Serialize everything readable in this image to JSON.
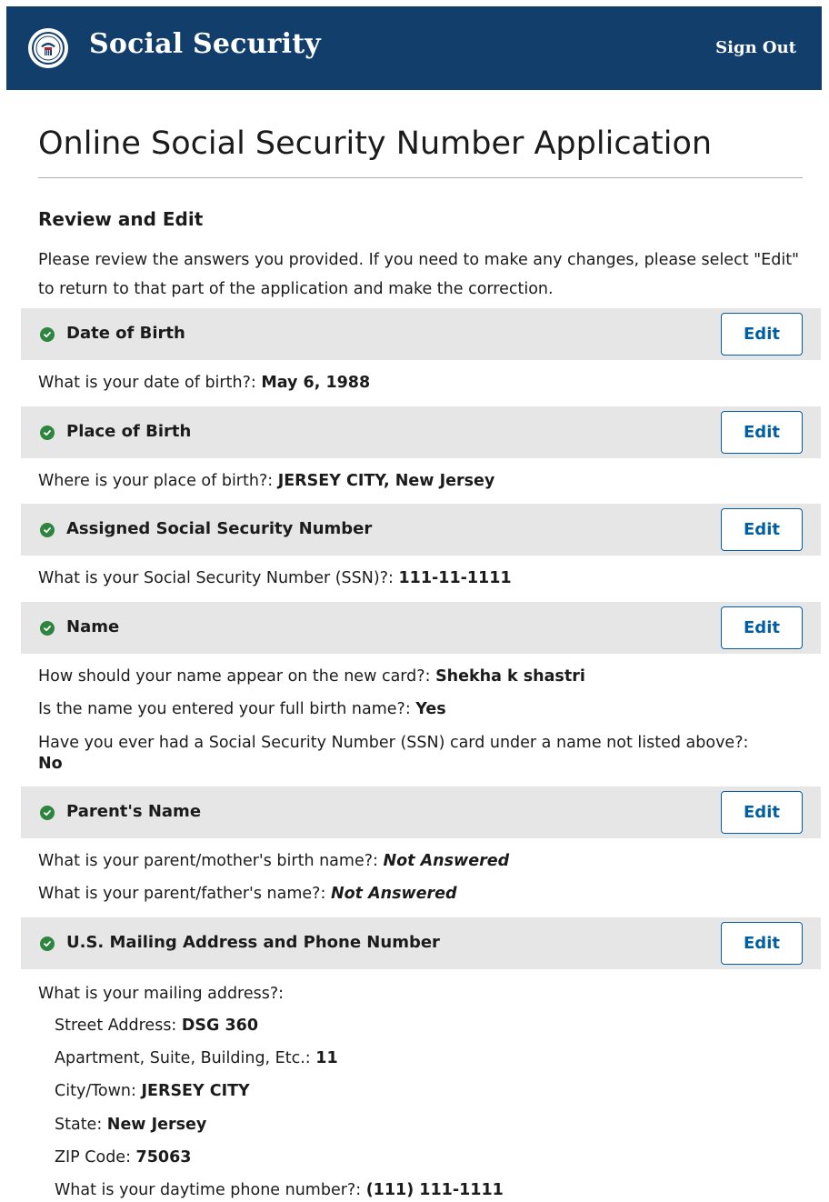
{
  "header": {
    "logo_text": "SOCIAL SECURITY ADMINISTRATION USA",
    "brand": "Social Security",
    "sign_out": "Sign Out"
  },
  "page": {
    "title": "Online Social Security Number Application",
    "review_heading": "Review and Edit",
    "review_intro": "Please review the answers you provided. If you need to make any changes, please select \"Edit\" to return to that part of the application and make the correction."
  },
  "colors": {
    "header_bg": "#123e6b",
    "section_bg": "#e6e6e6",
    "check": "#2e8540",
    "edit_blue": "#005ea2"
  },
  "sections": [
    {
      "title": "Date of Birth",
      "edit": "Edit",
      "qa": [
        {
          "q": "What is your date of birth?:",
          "a": "May 6, 1988"
        }
      ]
    },
    {
      "title": "Place of Birth",
      "edit": "Edit",
      "qa": [
        {
          "q": "Where is your place of birth?:",
          "a": "JERSEY CITY, New Jersey"
        }
      ]
    },
    {
      "title": "Assigned Social Security Number",
      "edit": "Edit",
      "qa": [
        {
          "q": "What is your Social Security Number (SSN)?:",
          "a": "111-11-1111"
        }
      ]
    },
    {
      "title": "Name",
      "edit": "Edit",
      "qa": [
        {
          "q": "How should your name appear on the new card?:",
          "a": "Shekha k shastri"
        },
        {
          "q": "Is the name you entered your full birth name?:",
          "a": "Yes"
        },
        {
          "q": "Have you ever had a Social Security Number (SSN) card under a name not listed above?:",
          "a": "No"
        }
      ]
    },
    {
      "title": "Parent's Name",
      "edit": "Edit",
      "qa": [
        {
          "q": "What is your parent/mother's birth name?:",
          "a": "Not Answered"
        },
        {
          "q": "What is your parent/father's name?:",
          "a": "Not Answered"
        }
      ]
    },
    {
      "title": "U.S. Mailing Address and Phone Number",
      "edit": "Edit",
      "qa": [
        {
          "q": "What is your mailing address?:",
          "a": ""
        },
        {
          "q": "Street Address:",
          "a": "DSG 360"
        },
        {
          "q": "Apartment, Suite, Building, Etc.:",
          "a": "11"
        },
        {
          "q": "City/Town:",
          "a": "JERSEY CITY"
        },
        {
          "q": "State:",
          "a": "New Jersey"
        },
        {
          "q": "ZIP Code:",
          "a": "75063"
        },
        {
          "q": "What is your daytime phone number?:",
          "a": "(111) 111-1111"
        }
      ]
    }
  ]
}
